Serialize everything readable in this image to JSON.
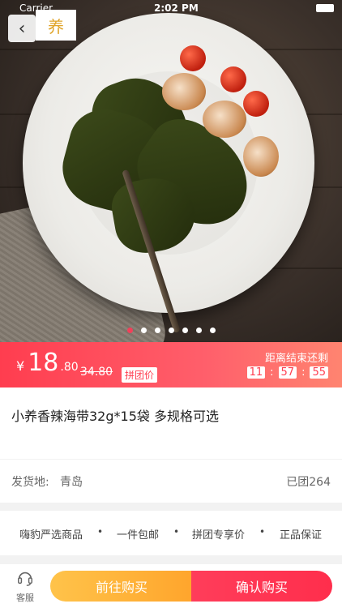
{
  "status_bar": {
    "carrier": "Carrier",
    "time": "2:02 PM"
  },
  "header": {
    "back_icon": "back-arrow-icon",
    "logo_text": "养"
  },
  "carousel": {
    "dots": 7,
    "active_index": 0
  },
  "price": {
    "currency": "¥",
    "integer": "18",
    "decimal": ".80",
    "original": "34.80",
    "group_tag": "拼团价",
    "countdown_label": "距离结束还剩",
    "countdown": [
      "11",
      "57",
      "55"
    ],
    "separator": ":"
  },
  "product": {
    "title": "小养香辣海带32g*15袋 多规格可选"
  },
  "info": {
    "ship_label": "发货地:",
    "ship_city": "青岛",
    "group_count": "已团264"
  },
  "tags": [
    "嗨豹严选商品",
    "一件包邮",
    "拼团专享价",
    "正品保证"
  ],
  "bottom": {
    "service_label": "客服",
    "go_buy": "前往购买",
    "confirm_buy": "确认购买"
  },
  "colors": {
    "accent": "#ff3d4f",
    "buy_left": "#ffb33a",
    "buy_right": "#ff2e4c"
  }
}
